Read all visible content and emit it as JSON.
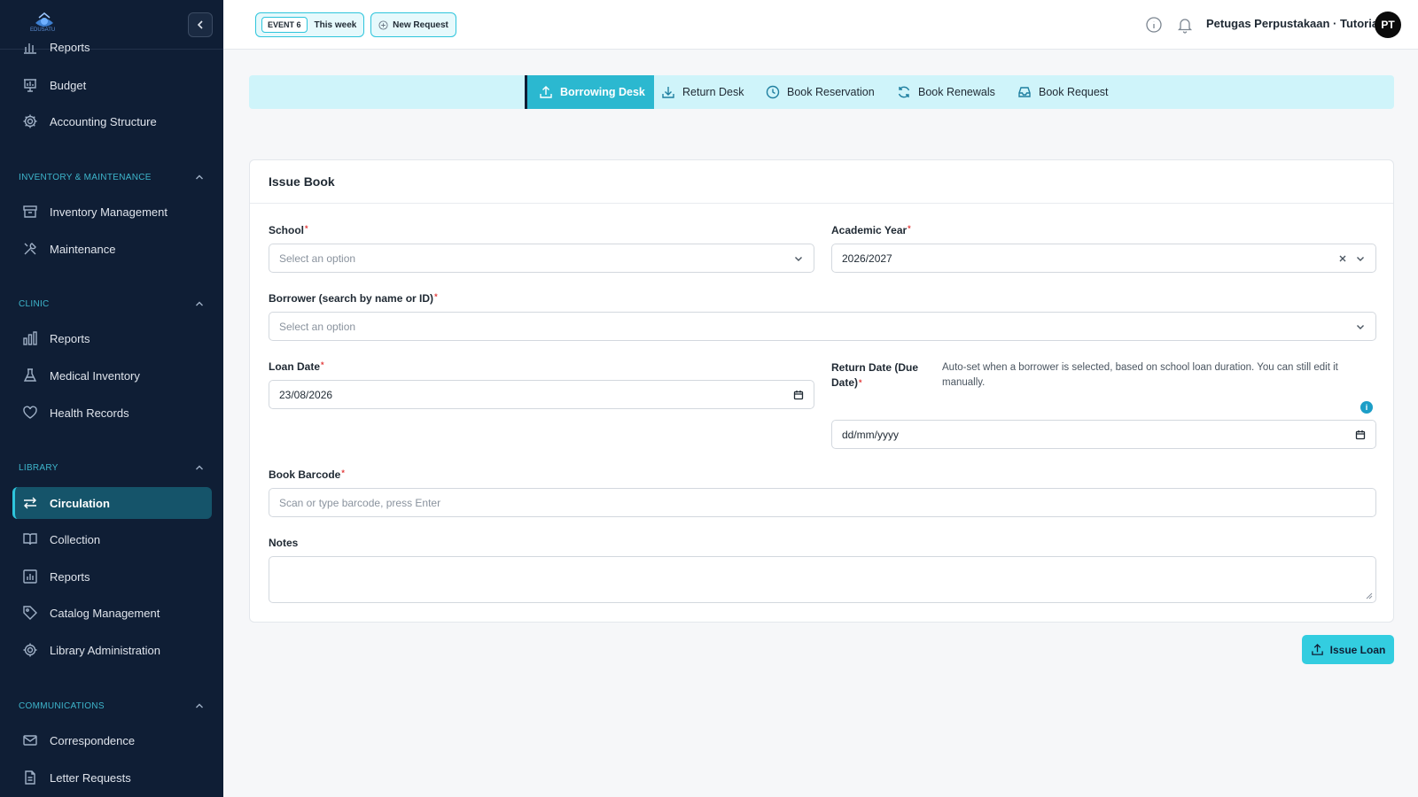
{
  "sidebar": {
    "logo_text": "EDUSATU",
    "items_top": [
      {
        "label": "Reports",
        "icon": "bar-chart-icon"
      },
      {
        "label": "Budget",
        "icon": "presentation-chart-icon"
      },
      {
        "label": "Accounting Structure",
        "icon": "gear-icon"
      }
    ],
    "sections": [
      {
        "title": "INVENTORY & MAINTENANCE",
        "items": [
          {
            "label": "Inventory Management",
            "icon": "archive-box-icon"
          },
          {
            "label": "Maintenance",
            "icon": "wrench-screwdriver-icon"
          }
        ]
      },
      {
        "title": "CLINIC",
        "items": [
          {
            "label": "Reports",
            "icon": "bar-chart-icon"
          },
          {
            "label": "Medical Inventory",
            "icon": "beaker-icon"
          },
          {
            "label": "Health Records",
            "icon": "heart-icon"
          }
        ]
      },
      {
        "title": "LIBRARY",
        "items": [
          {
            "label": "Circulation",
            "icon": "arrows-exchange-icon",
            "active": true
          },
          {
            "label": "Collection",
            "icon": "open-book-icon"
          },
          {
            "label": "Reports",
            "icon": "presentation-chart-icon"
          },
          {
            "label": "Catalog Management",
            "icon": "tag-icon"
          },
          {
            "label": "Library Administration",
            "icon": "gear-icon"
          }
        ]
      },
      {
        "title": "COMMUNICATIONS",
        "items": [
          {
            "label": "Correspondence",
            "icon": "envelope-icon"
          },
          {
            "label": "Letter Requests",
            "icon": "document-icon"
          }
        ]
      }
    ]
  },
  "topbar": {
    "event_badge": "EVENT 6",
    "event_period": "This week",
    "new_request": "New Request",
    "user_name": "Petugas Perpustakaan · Tutorial",
    "avatar_initials": "PT"
  },
  "tabs": [
    {
      "label": "Borrowing Desk",
      "icon": "upload-tray-icon",
      "active": true
    },
    {
      "label": "Return Desk",
      "icon": "download-tray-icon"
    },
    {
      "label": "Book Reservation",
      "icon": "clock-icon"
    },
    {
      "label": "Book Renewals",
      "icon": "refresh-icon"
    },
    {
      "label": "Book Request",
      "icon": "inbox-icon"
    }
  ],
  "form": {
    "title": "Issue Book",
    "school_label": "School",
    "school_placeholder": "Select an option",
    "academic_year_label": "Academic Year",
    "academic_year_value": "2026/2027",
    "borrower_label": "Borrower (search by name or ID)",
    "borrower_placeholder": "Select an option",
    "loan_date_label": "Loan Date",
    "loan_date_value": "23/08/2026",
    "return_date_label_1": "Return Date (Due",
    "return_date_label_2": "Date)",
    "return_date_hint": "Auto-set when a borrower is selected, based on school loan duration. You can still edit it manually.",
    "return_date_placeholder": "dd/mm/yyyy",
    "barcode_label": "Book Barcode",
    "barcode_placeholder": "Scan or type barcode, press Enter",
    "notes_label": "Notes",
    "required_mark": "*",
    "info_mark": "i"
  },
  "actions": {
    "issue_loan": "Issue Loan"
  },
  "colors": {
    "sidebar_bg": "#0f1e35",
    "accent": "#2bb8d0",
    "accent_light": "#cff4fa",
    "required": "#e23b3b"
  }
}
